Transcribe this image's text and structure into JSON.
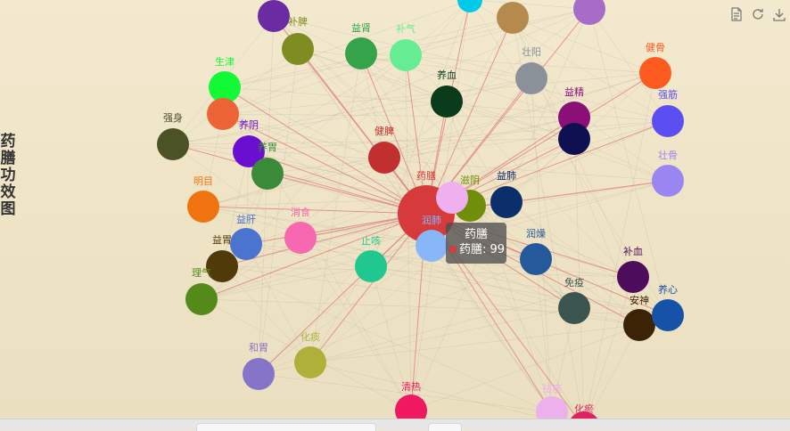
{
  "title": "药膳功效图",
  "tooltip": {
    "title": "药膳",
    "series": "药膳",
    "value": "99",
    "sep": ": "
  },
  "center": {
    "label": "药膳",
    "color": "#d63a3a"
  },
  "nodes": [
    {
      "label": "",
      "color": "#6b2ba3"
    },
    {
      "label": "",
      "color": "#b68a4c"
    },
    {
      "label": "",
      "color": "#a66cc8"
    },
    {
      "label": "补脾",
      "color": "#7f8c22"
    },
    {
      "label": "益肾",
      "color": "#34a34a"
    },
    {
      "label": "补气",
      "color": "#66ed93"
    },
    {
      "label": "壮阳",
      "color": "#8a9198"
    },
    {
      "label": "健骨",
      "color": "#fd5a1f"
    },
    {
      "label": "生津",
      "color": "#12fa36"
    },
    {
      "label": "养血",
      "color": "#0a3b1a"
    },
    {
      "label": "益精",
      "color": "#8a1078"
    },
    {
      "label": "强筋",
      "color": "#5c4ff2"
    },
    {
      "label": "强身",
      "color": "#4b5225"
    },
    {
      "label": "",
      "color": "#ec6436"
    },
    {
      "label": "养阴",
      "color": "#6a0fd0"
    },
    {
      "label": "",
      "color": "#0f1052"
    },
    {
      "label": "健脾",
      "color": "#c22f2f"
    },
    {
      "label": "养胃",
      "color": "#3a8a3a"
    },
    {
      "label": "壮骨",
      "color": "#9a86f0"
    },
    {
      "label": "明目",
      "color": "#ef7410"
    },
    {
      "label": "滋阴",
      "color": "#6f8f0a"
    },
    {
      "label": "益肺",
      "color": "#0b2f6a"
    },
    {
      "label": "",
      "color": "#f0b0f0"
    },
    {
      "label": "益肝",
      "color": "#4a74d0"
    },
    {
      "label": "消食",
      "color": "#f868b0"
    },
    {
      "label": "润肺",
      "color": "#89b6f8"
    },
    {
      "label": "益胃",
      "color": "#503a0a"
    },
    {
      "label": "止咳",
      "color": "#20c890"
    },
    {
      "label": "润燥",
      "color": "#245a9c"
    },
    {
      "label": "补血",
      "color": "#4e0c5c"
    },
    {
      "label": "理气",
      "color": "#548a1a"
    },
    {
      "label": "免疫",
      "color": "#3c5550"
    },
    {
      "label": "安神",
      "color": "#3c2306"
    },
    {
      "label": "养心",
      "color": "#1552a8"
    },
    {
      "label": "和胃",
      "color": "#8674c8"
    },
    {
      "label": "化痰",
      "color": "#aeb03a"
    },
    {
      "label": "清热",
      "color": "#f01860"
    },
    {
      "label": "祛痰",
      "color": "#ecb0ec"
    },
    {
      "label": "化瘀",
      "color": "#e02060"
    },
    {
      "label": "",
      "color": "#00c8e8"
    }
  ]
}
